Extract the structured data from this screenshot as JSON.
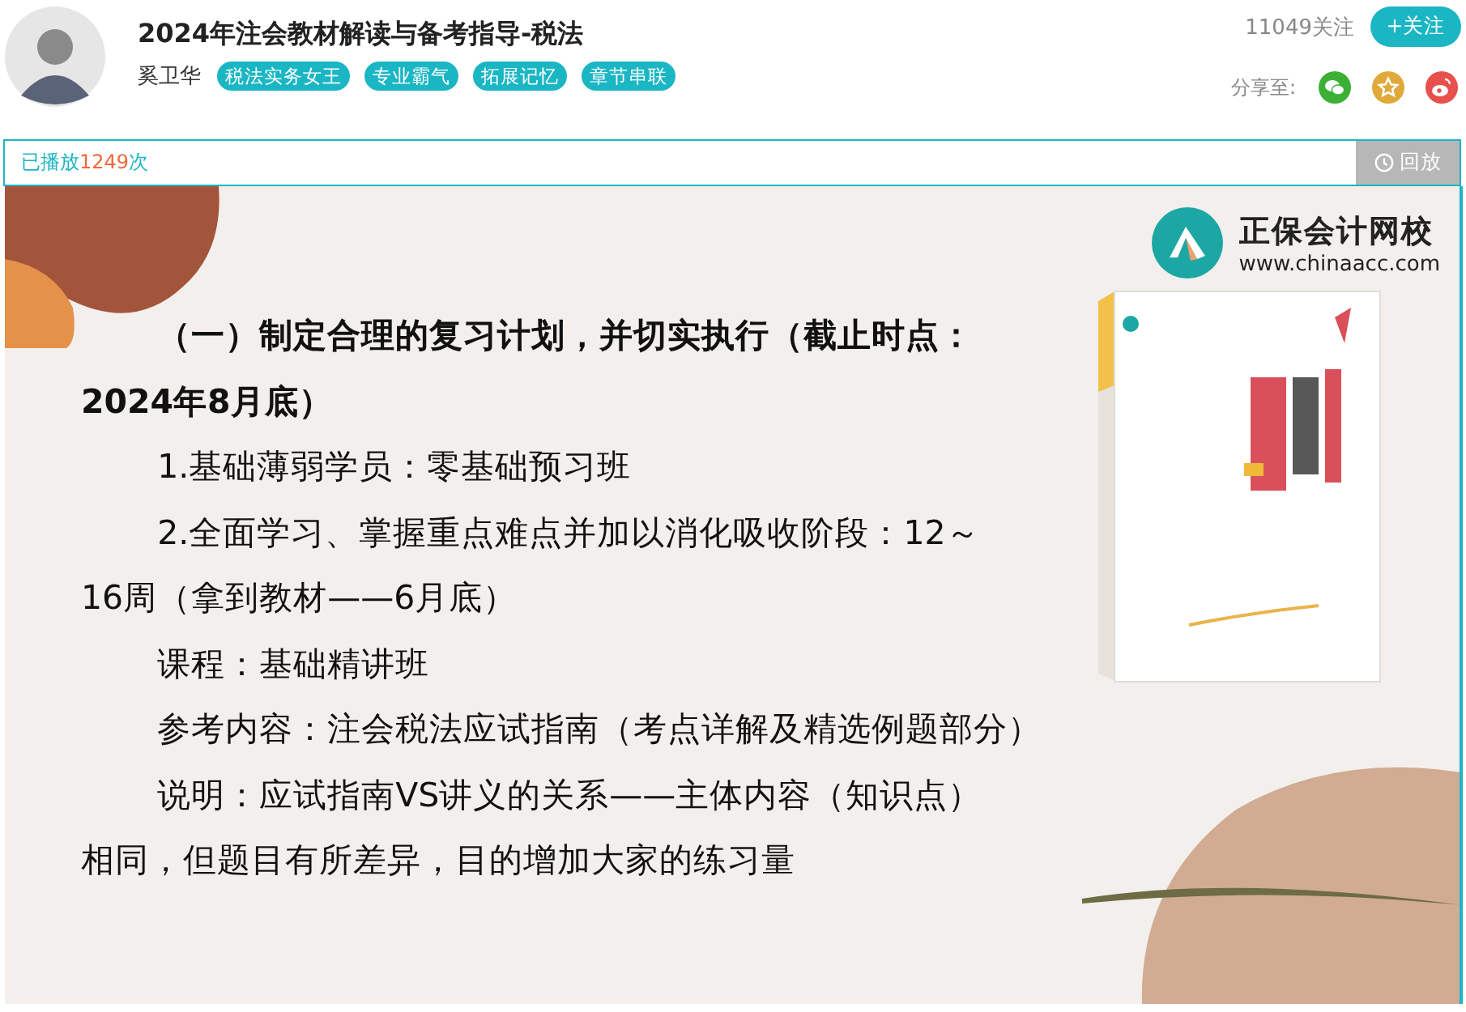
{
  "header": {
    "title": "2024年注会教材解读与备考指导-税法",
    "teacher": "奚卫华",
    "tags": [
      "税法实务女王",
      "专业霸气",
      "拓展记忆",
      "章节串联"
    ],
    "followers": "11049关注",
    "follow_button": "+关注",
    "share_label": "分享至:"
  },
  "play_bar": {
    "prefix": "已播放",
    "count": "1249",
    "suffix": "次",
    "replay_button": "回放"
  },
  "slide": {
    "logo_name": "正保会计网校",
    "logo_url": "www.chinaacc.com",
    "paragraphs": [
      {
        "kind": "heading",
        "lines": [
          "（一）制定合理的复习计划，并切实执行（截止时点：",
          "2024年8月底）"
        ]
      },
      {
        "kind": "body",
        "lines": [
          "1.基础薄弱学员：零基础预习班"
        ]
      },
      {
        "kind": "body",
        "lines": [
          "2.全面学习、掌握重点难点并加以消化吸收阶段：12～",
          "16周（拿到教材——6月底）"
        ]
      },
      {
        "kind": "body",
        "lines": [
          "课程：基础精讲班"
        ]
      },
      {
        "kind": "body",
        "lines": [
          "参考内容：注会税法应试指南（考点详解及精选例题部分）"
        ]
      },
      {
        "kind": "body",
        "lines": [
          "说明：应试指南VS讲义的关系——主体内容（知识点）",
          "相同，但题目有所差异，目的增加大家的练习量"
        ]
      }
    ]
  }
}
